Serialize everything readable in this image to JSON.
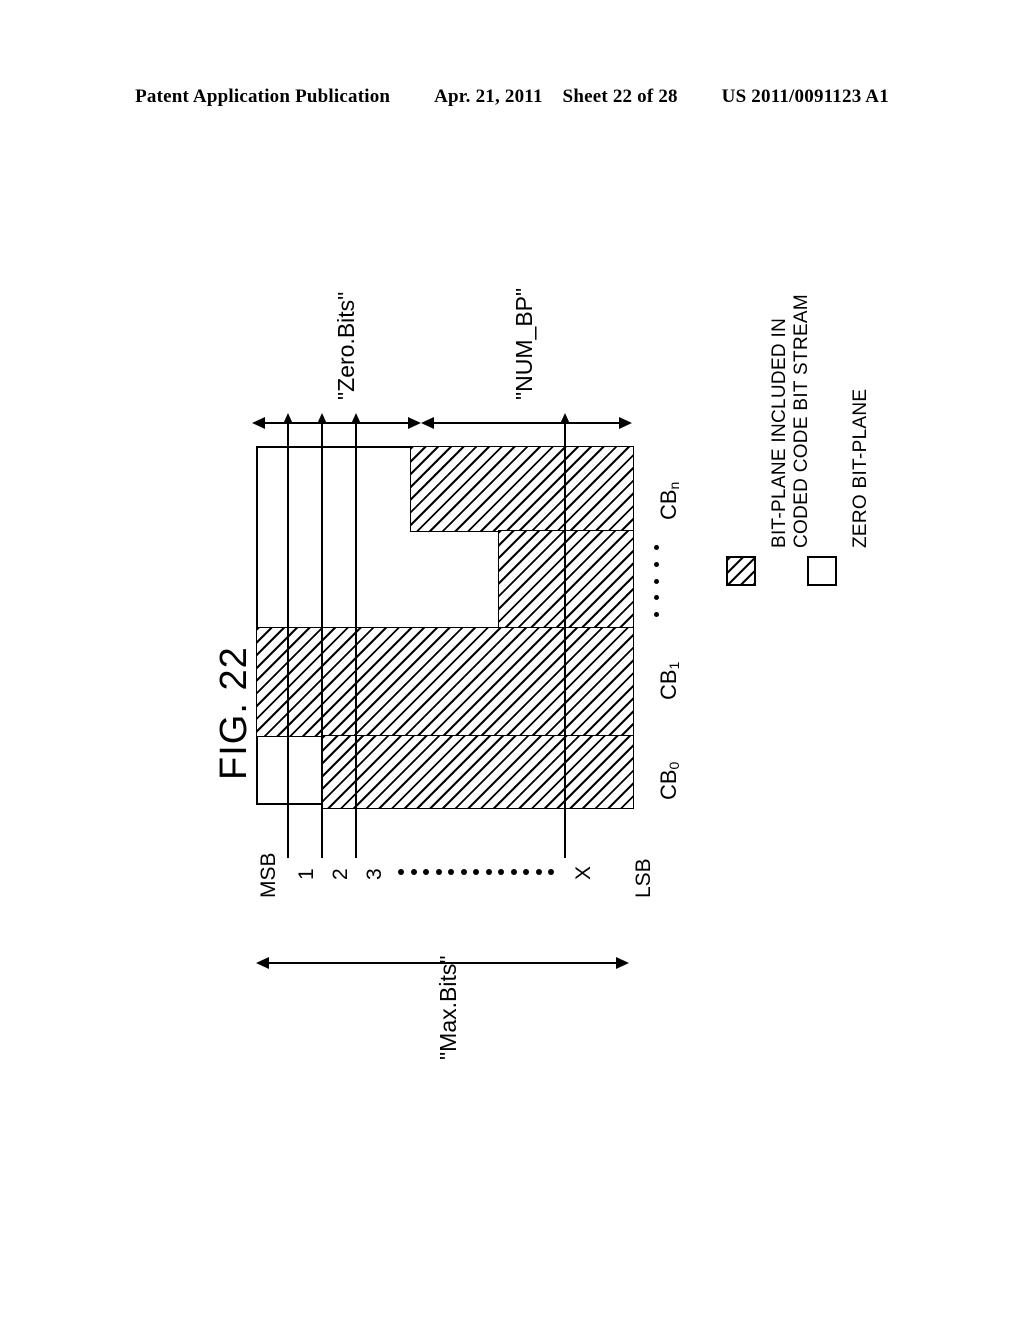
{
  "header": {
    "publication": "Patent Application Publication",
    "date": "Apr. 21, 2011",
    "sheet": "Sheet 22 of 28",
    "doc_number": "US 2011/0091123 A1"
  },
  "figure": {
    "title": "FIG. 22",
    "bit_axis": {
      "msb_label": "MSB",
      "lsb_label": "LSB",
      "tick_labels": [
        "1",
        "2",
        "3"
      ],
      "last_tick_label": "X",
      "ellipsis_count": 13
    },
    "dimensions": {
      "zero_bits": "\"Zero.Bits\"",
      "num_bp": "\"NUM_BP\"",
      "max_bits": "\"Max.Bits\""
    },
    "code_blocks": {
      "first": "CB",
      "first_sub": "0",
      "second": "CB",
      "second_sub": "1",
      "last": "CB",
      "last_sub": "n",
      "ellipsis_count": 5
    }
  },
  "legend": {
    "items": [
      {
        "swatch": "hatched-box",
        "label_line1": "BIT-PLANE INCLUDED IN",
        "label_line2": "CODED CODE BIT STREAM"
      },
      {
        "swatch": "empty-box",
        "label_line1": "ZERO BIT-PLANE",
        "label_line2": ""
      }
    ]
  },
  "colors": {
    "ink": "#000000",
    "paper": "#ffffff"
  }
}
